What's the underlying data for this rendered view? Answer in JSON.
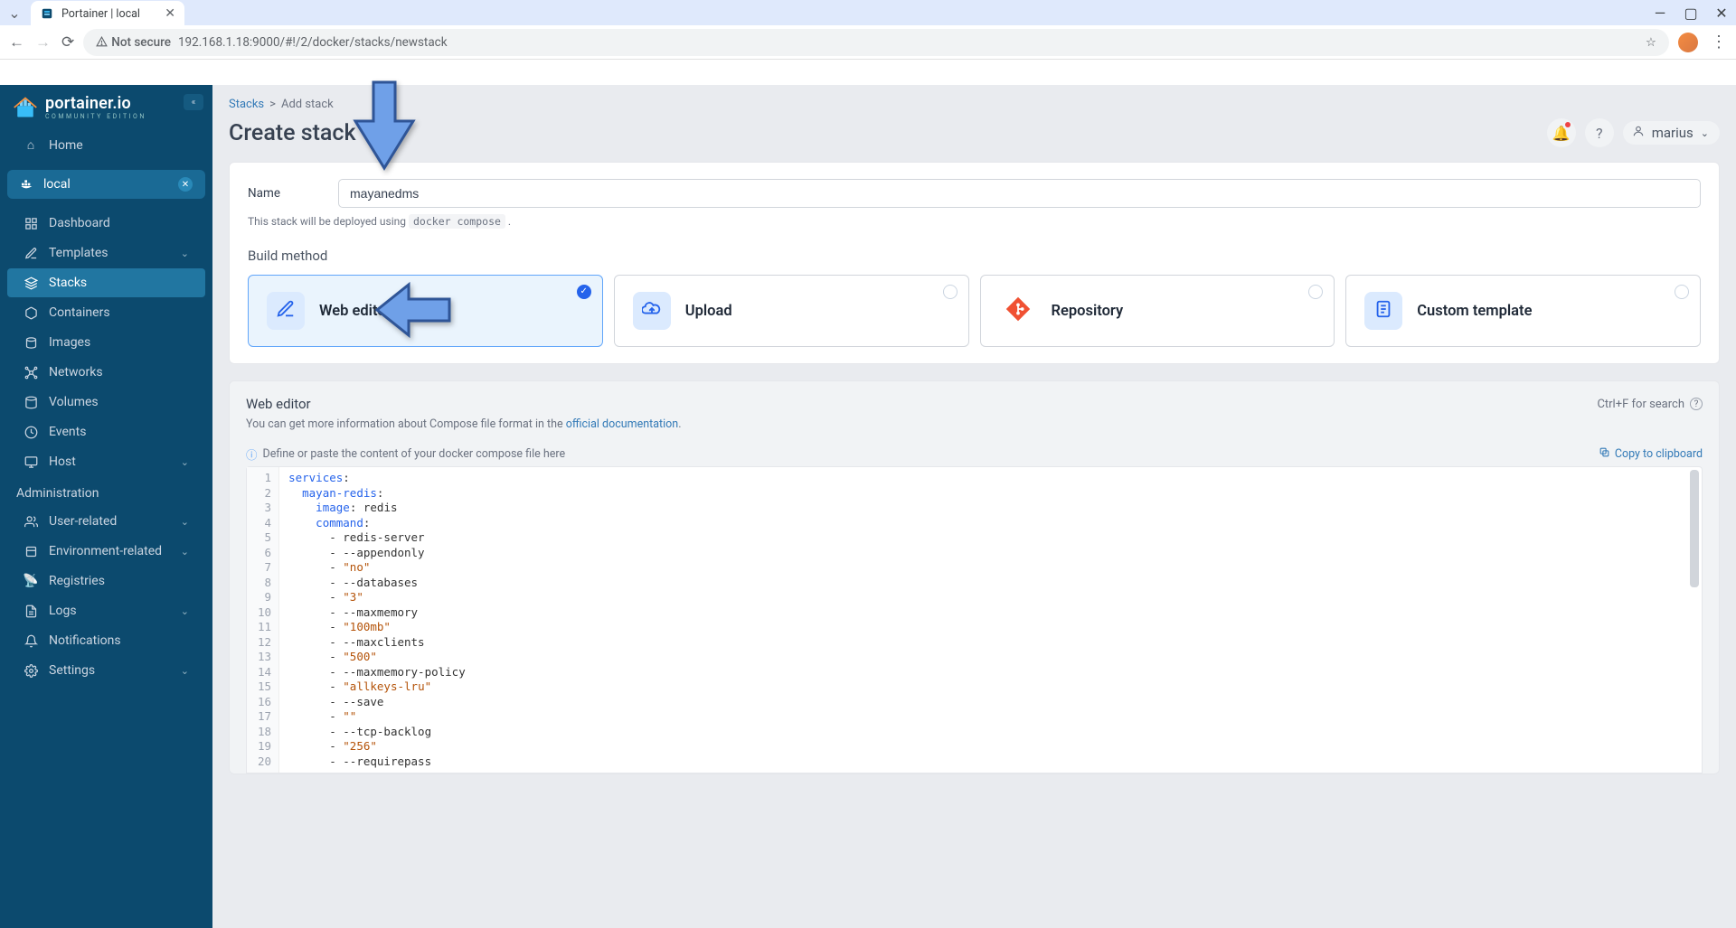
{
  "browser": {
    "tab_title": "Portainer | local",
    "url": "192.168.1.18:9000/#!/2/docker/stacks/newstack",
    "not_secure": "Not secure"
  },
  "sidebar": {
    "brand_main": "portainer.io",
    "brand_sub": "COMMUNITY EDITION",
    "home": "Home",
    "env_name": "local",
    "items": [
      {
        "icon": "dashboard",
        "label": "Dashboard"
      },
      {
        "icon": "templates",
        "label": "Templates",
        "expandable": true
      },
      {
        "icon": "stacks",
        "label": "Stacks",
        "active": true
      },
      {
        "icon": "containers",
        "label": "Containers"
      },
      {
        "icon": "images",
        "label": "Images"
      },
      {
        "icon": "networks",
        "label": "Networks"
      },
      {
        "icon": "volumes",
        "label": "Volumes"
      },
      {
        "icon": "events",
        "label": "Events"
      },
      {
        "icon": "host",
        "label": "Host",
        "expandable": true
      }
    ],
    "admin_header": "Administration",
    "admin_items": [
      {
        "icon": "users",
        "label": "User-related",
        "expandable": true
      },
      {
        "icon": "env",
        "label": "Environment-related",
        "expandable": true
      },
      {
        "icon": "registries",
        "label": "Registries"
      },
      {
        "icon": "logs",
        "label": "Logs",
        "expandable": true
      },
      {
        "icon": "notifications",
        "label": "Notifications"
      },
      {
        "icon": "settings",
        "label": "Settings",
        "expandable": true
      }
    ]
  },
  "breadcrumb": {
    "stacks": "Stacks",
    "sep": ">",
    "current": "Add stack"
  },
  "page": {
    "title": "Create stack"
  },
  "header": {
    "username": "marius"
  },
  "form": {
    "name_label": "Name",
    "name_value": "mayanedms",
    "helper_pre": "This stack will be deployed using ",
    "helper_code": "docker compose",
    "helper_post": " .",
    "build_method_label": "Build method",
    "methods": {
      "web_editor": "Web editor",
      "upload": "Upload",
      "repository": "Repository",
      "custom_template": "Custom template"
    }
  },
  "editor": {
    "title": "Web editor",
    "search_hint": "Ctrl+F for search",
    "info_pre": "You can get more information about Compose file format in the ",
    "info_link": "official documentation",
    "info_post": ".",
    "placeholder_hint": "Define or paste the content of your docker compose file here",
    "copy_label": "Copy to clipboard",
    "lines": [
      {
        "n": 1,
        "type": "key",
        "indent": 0,
        "text": "services"
      },
      {
        "n": 2,
        "type": "key",
        "indent": 1,
        "text": "mayan-redis"
      },
      {
        "n": 3,
        "type": "kv",
        "indent": 2,
        "key": "image",
        "val": "redis"
      },
      {
        "n": 4,
        "type": "key",
        "indent": 2,
        "text": "command"
      },
      {
        "n": 5,
        "type": "item",
        "indent": 3,
        "text": "redis-server"
      },
      {
        "n": 6,
        "type": "item",
        "indent": 3,
        "text": "--appendonly"
      },
      {
        "n": 7,
        "type": "item-str",
        "indent": 3,
        "text": "\"no\""
      },
      {
        "n": 8,
        "type": "item",
        "indent": 3,
        "text": "--databases"
      },
      {
        "n": 9,
        "type": "item-str",
        "indent": 3,
        "text": "\"3\""
      },
      {
        "n": 10,
        "type": "item",
        "indent": 3,
        "text": "--maxmemory"
      },
      {
        "n": 11,
        "type": "item-str",
        "indent": 3,
        "text": "\"100mb\""
      },
      {
        "n": 12,
        "type": "item",
        "indent": 3,
        "text": "--maxclients"
      },
      {
        "n": 13,
        "type": "item-str",
        "indent": 3,
        "text": "\"500\""
      },
      {
        "n": 14,
        "type": "item",
        "indent": 3,
        "text": "--maxmemory-policy"
      },
      {
        "n": 15,
        "type": "item-str",
        "indent": 3,
        "text": "\"allkeys-lru\""
      },
      {
        "n": 16,
        "type": "item",
        "indent": 3,
        "text": "--save"
      },
      {
        "n": 17,
        "type": "item-str",
        "indent": 3,
        "text": "\"\""
      },
      {
        "n": 18,
        "type": "item",
        "indent": 3,
        "text": "--tcp-backlog"
      },
      {
        "n": 19,
        "type": "item-str",
        "indent": 3,
        "text": "\"256\""
      },
      {
        "n": 20,
        "type": "item",
        "indent": 3,
        "text": "--requirepass"
      }
    ]
  }
}
